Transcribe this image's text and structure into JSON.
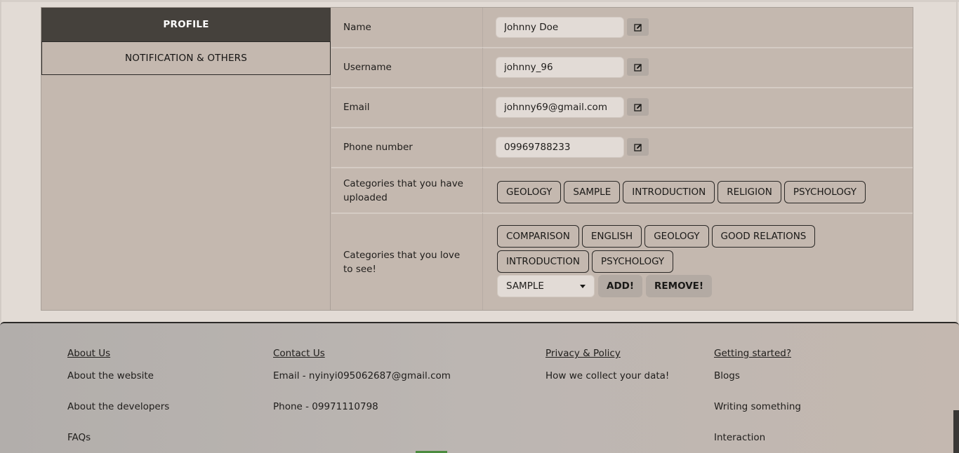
{
  "tabs": {
    "profile": "PROFILE",
    "notifications": "NOTIFICATION & OTHERS"
  },
  "profile": {
    "name": {
      "label": "Name",
      "value": "Johnny Doe"
    },
    "username": {
      "label": "Username",
      "value": "johnny_96"
    },
    "email": {
      "label": "Email",
      "value": "johnny69@gmail.com"
    },
    "phone": {
      "label": "Phone number",
      "value": "09969788233"
    },
    "uploaded": {
      "label": "Categories that you have uploaded",
      "tags": [
        "GEOLOGY",
        "SAMPLE",
        "INTRODUCTION",
        "RELIGION",
        "PSYCHOLOGY"
      ]
    },
    "loved": {
      "label": "Categories that you love to see!",
      "tags": [
        "COMPARISON",
        "ENGLISH",
        "GEOLOGY",
        "GOOD RELATIONS",
        "INTRODUCTION",
        "PSYCHOLOGY"
      ],
      "select_value": "SAMPLE",
      "add_label": "ADD!",
      "remove_label": "REMOVE!"
    }
  },
  "footer": {
    "about": {
      "heading": "About Us",
      "links": [
        "About the website",
        "About the developers",
        "FAQs"
      ]
    },
    "contact": {
      "heading": "Contact Us",
      "links": [
        "Email - nyinyi095062687@gmail.com",
        "Phone - 09971110798"
      ]
    },
    "privacy": {
      "heading": "Privacy & Policy",
      "links": [
        "How we collect your data!"
      ]
    },
    "started": {
      "heading": "Getting started?",
      "links": [
        "Blogs",
        "Writing something",
        "Interaction"
      ]
    }
  },
  "icons": {
    "edit": "edit-pencil-icon",
    "dropdown": "caret-down-icon"
  }
}
